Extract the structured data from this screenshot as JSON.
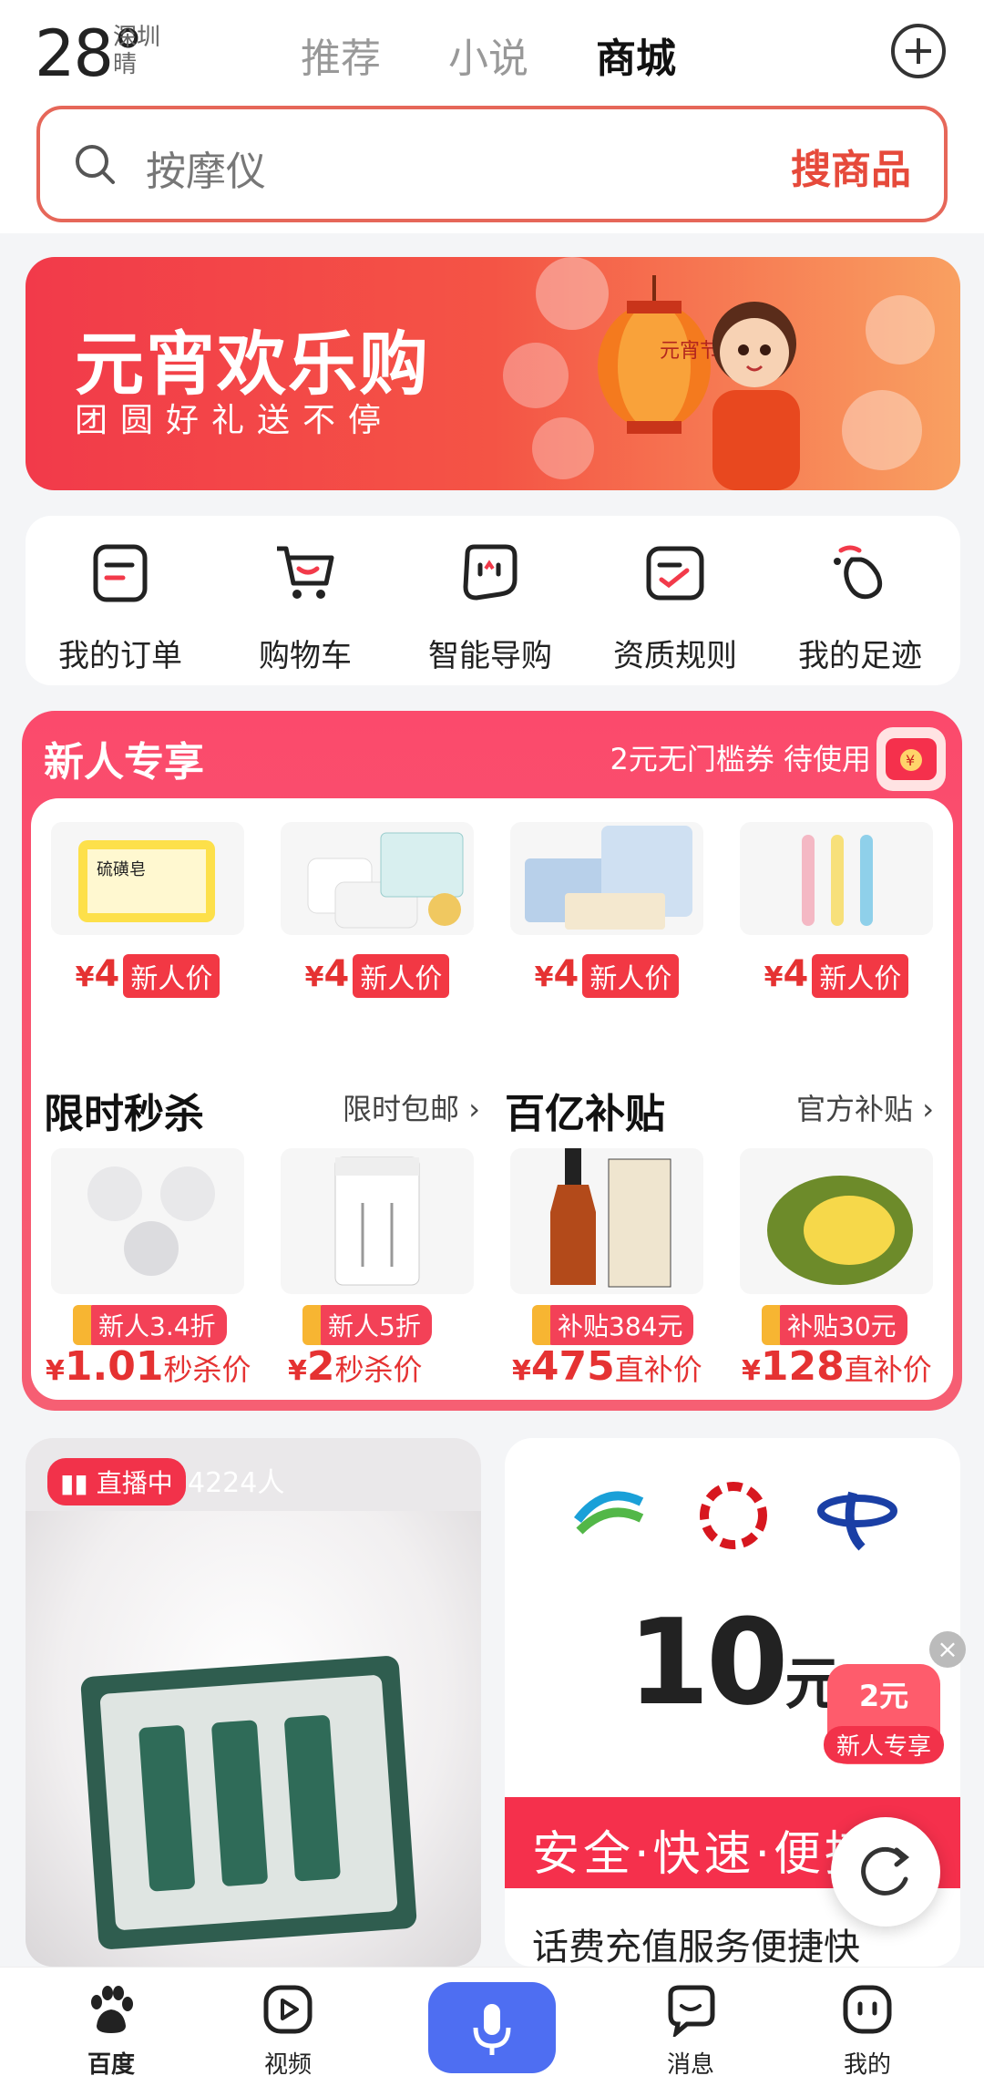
{
  "status": {
    "temperature": "28°",
    "city": "深圳",
    "weather": "晴"
  },
  "tabs": [
    {
      "label": "推荐",
      "active": false
    },
    {
      "label": "小说",
      "active": false
    },
    {
      "label": "商城",
      "active": true
    }
  ],
  "search": {
    "placeholder": "按摩仪",
    "button_label": "搜商品"
  },
  "banner": {
    "title": "元宵欢乐购",
    "subtitle": "团圆好礼送不停",
    "lantern_text": "元宵节"
  },
  "quick_nav": [
    {
      "label": "我的订单",
      "icon": "order-icon"
    },
    {
      "label": "购物车",
      "icon": "cart-icon"
    },
    {
      "label": "智能导购",
      "icon": "ai-guide-icon"
    },
    {
      "label": "资质规则",
      "icon": "rules-icon"
    },
    {
      "label": "我的足迹",
      "icon": "footprint-icon"
    }
  ],
  "newcomer": {
    "title": "新人专享",
    "coupon_text": "2元无门槛券 待使用",
    "products": [
      {
        "price": "4",
        "tag": "新人价",
        "img_label": "硫磺皂"
      },
      {
        "price": "4",
        "tag": "新人价",
        "img_label": ""
      },
      {
        "price": "4",
        "tag": "新人价",
        "img_label": ""
      },
      {
        "price": "4",
        "tag": "新人价",
        "img_label": ""
      }
    ]
  },
  "flash_sale": {
    "title": "限时秒杀",
    "link": "限时包邮",
    "items": [
      {
        "chip": "新人3.4折",
        "price": "1.01",
        "suffix": "秒杀价"
      },
      {
        "chip": "新人5折",
        "price": "2",
        "suffix": "秒杀价"
      }
    ]
  },
  "subsidy": {
    "title": "百亿补贴",
    "link": "官方补贴",
    "items": [
      {
        "chip": "补贴384元",
        "price": "475",
        "suffix": "直补价"
      },
      {
        "chip": "补贴30元",
        "price": "128",
        "suffix": "直补价"
      }
    ]
  },
  "live_card": {
    "badge": "直播中",
    "viewers": "4224人"
  },
  "topup_card": {
    "amount": "10",
    "unit": "元",
    "slogan": "安全·快速·便捷",
    "description": "话费充值服务便捷快"
  },
  "floating": {
    "value": "2元",
    "label": "新人专享",
    "close": "×"
  },
  "bottom_nav": [
    {
      "label": "百度",
      "active": true
    },
    {
      "label": "视频",
      "active": false
    },
    {
      "label": "消息",
      "active": false
    },
    {
      "label": "我的",
      "active": false
    }
  ],
  "colors": {
    "accent": "#e64a3b",
    "brand_blue": "#4e6ef2",
    "promo_pink": "#fb4a6c"
  }
}
